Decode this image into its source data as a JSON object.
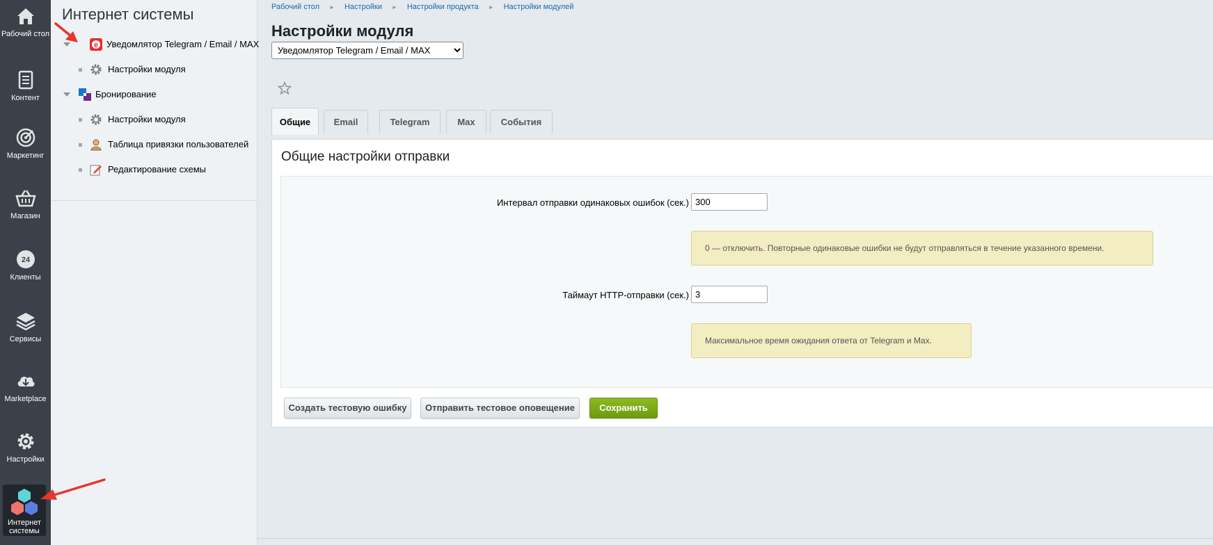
{
  "rail": [
    {
      "name": "rail-desktop",
      "label": "Рабочий стол",
      "icon": "home-icon"
    },
    {
      "name": "rail-content",
      "label": "Контент",
      "icon": "document-icon"
    },
    {
      "name": "rail-marketing",
      "label": "Маркетинг",
      "icon": "target-icon"
    },
    {
      "name": "rail-shop",
      "label": "Магазин",
      "icon": "basket-icon"
    },
    {
      "name": "rail-clients",
      "label": "Клиенты",
      "icon": "clock-24-icon",
      "badge": "24"
    },
    {
      "name": "rail-services",
      "label": "Сервисы",
      "icon": "layers-icon"
    },
    {
      "name": "rail-marketplace",
      "label": "Marketplace",
      "icon": "cloud-download-icon"
    },
    {
      "name": "rail-settings",
      "label": "Настройки",
      "icon": "gear-icon"
    },
    {
      "name": "rail-internet",
      "label": "Интернет системы",
      "icon": "cubes-icon"
    }
  ],
  "menu": {
    "title": "Интернет системы",
    "items": [
      {
        "label": "Уведомлятор Telegram / Email / MAX",
        "type": "group",
        "icon": "e-logo-icon"
      },
      {
        "label": "Настройки модуля",
        "type": "child",
        "icon": "gear-icon"
      },
      {
        "label": "Бронирование",
        "type": "group",
        "icon": "booking-logo-icon"
      },
      {
        "label": "Настройки модуля",
        "type": "child",
        "icon": "gear-icon"
      },
      {
        "label": "Таблица привязки пользователей",
        "type": "child",
        "icon": "user-icon"
      },
      {
        "label": "Редактирование схемы",
        "type": "child",
        "icon": "edit-icon"
      }
    ]
  },
  "breadcrumb": [
    "Рабочий стол",
    "Настройки",
    "Настройки продукта",
    "Настройки модулей"
  ],
  "page_title": "Настройки модуля",
  "module_select": {
    "selected": "Уведомлятор Telegram / Email / MAX"
  },
  "tabs": [
    "Общие",
    "Email",
    "Telegram",
    "Max",
    "События"
  ],
  "active_tab": "Общие",
  "section_title": "Общие настройки отправки",
  "fields": [
    {
      "label": "Интервал отправки одинаковых ошибок (сек.)",
      "value": "300",
      "hint": "0 — отключить. Повторные одинаковые ошибки не будут отправляться в течение указанного времени."
    },
    {
      "label": "Таймаут HTTP-отправки (сек.)",
      "value": "3",
      "hint": "Максимальное время ожидания ответа от Telegram и Max."
    }
  ],
  "buttons": {
    "test_error": "Создать тестовую ошибку",
    "test_notify": "Отправить тестовое оповещение",
    "save": "Сохранить"
  },
  "colors": {
    "rail_bg": "#3a4148",
    "save_green": "#7aab17",
    "hint_bg": "#f3edc2",
    "annotation_red": "#e8352b"
  }
}
